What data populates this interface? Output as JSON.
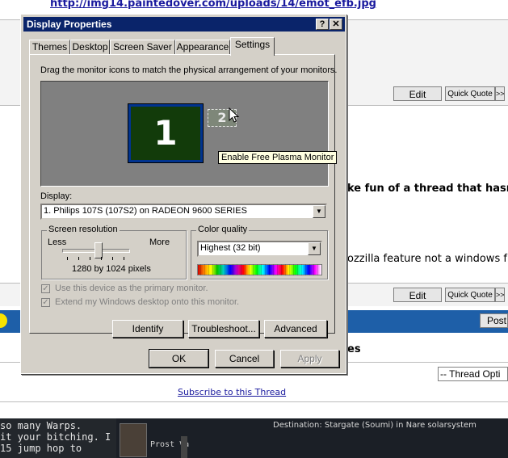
{
  "background": {
    "top_link": "http://img14.paintedover.com/uploads/14/emot_efb.jpg",
    "buttons": {
      "edit": "Edit",
      "quick_quote": "Quick Quote",
      "more": ">>"
    },
    "snippet_1": "ke fun of a thread that hasn'",
    "snippet_2": "ozzilla feature not a windows f",
    "snippet_3": "es",
    "post_button": "Post",
    "thread_options": "-- Thread Opti",
    "subscribe": "Subscribe to this Thread",
    "game": {
      "chat_lines": [
        "so many Warps.",
        "it your bitching. I",
        "15 jump hop to"
      ],
      "pilot_name": "Prost Va",
      "destination": "Destination: Stargate (Soumi) in Nare solarsystem"
    }
  },
  "dialog": {
    "title": "Display Properties",
    "title_buttons": {
      "help": "?",
      "close": "✕"
    },
    "tabs": [
      {
        "label": "Themes"
      },
      {
        "label": "Desktop"
      },
      {
        "label": "Screen Saver"
      },
      {
        "label": "Appearance"
      },
      {
        "label": "Settings"
      }
    ],
    "active_tab": "Settings",
    "instructions": "Drag the monitor icons to match the physical arrangement of your monitors.",
    "monitors": {
      "primary": "1",
      "secondary": "2",
      "tooltip": "Enable Free Plasma Monitor"
    },
    "display": {
      "label": "Display:",
      "value": "1. Philips 107S (107S2) on RADEON 9600 SERIES"
    },
    "screen_resolution": {
      "label": "Screen resolution",
      "less": "Less",
      "more": "More",
      "value": "1280 by 1024 pixels",
      "slider_fraction": 0.55
    },
    "color_quality": {
      "label": "Color quality",
      "value": "Highest (32 bit)"
    },
    "checkboxes": [
      {
        "label": "Use this device as the primary monitor.",
        "checked": true,
        "disabled": true
      },
      {
        "label": "Extend my Windows desktop onto this monitor.",
        "checked": true,
        "disabled": true
      }
    ],
    "panel_buttons": {
      "identify": "Identify",
      "troubleshoot": "Troubleshoot...",
      "advanced": "Advanced"
    },
    "footer_buttons": {
      "ok": "OK",
      "cancel": "Cancel",
      "apply": "Apply"
    }
  },
  "colors": {
    "title_bar": "#0a246a",
    "dialog_face": "#d4d0c8",
    "monitor_area": "#808080",
    "primary_monitor": "#123b0a",
    "tooltip": "#ffffe1",
    "forum_bar": "#1e5fa8"
  }
}
